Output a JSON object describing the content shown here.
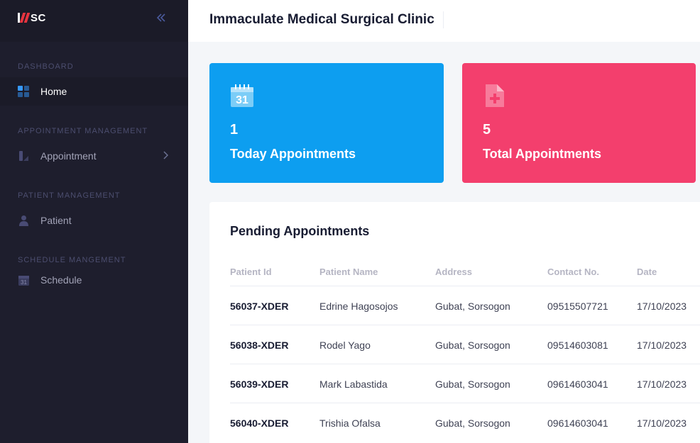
{
  "brand": {
    "logo_text": "SC"
  },
  "sidebar": {
    "sections": [
      {
        "label": "DASHBOARD"
      },
      {
        "label": "APPOINTMENT MANAGEMENT"
      },
      {
        "label": "PATIENT MANAGEMENT"
      },
      {
        "label": "SCHEDULE MANGEMENT"
      }
    ],
    "items": [
      {
        "label": "Home",
        "icon": "dashboard-grid-icon",
        "active": true
      },
      {
        "label": "Appointment",
        "icon": "appointment-icon",
        "has_submenu": true
      },
      {
        "label": "Patient",
        "icon": "user-icon"
      },
      {
        "label": "Schedule",
        "icon": "calendar-icon",
        "icon_text": "31"
      }
    ]
  },
  "header": {
    "title": "Immaculate Medical Surgical Clinic"
  },
  "stats": [
    {
      "value": "1",
      "label": "Today Appointments",
      "color": "#0d9ef0",
      "icon": "calendar-icon",
      "icon_text": "31"
    },
    {
      "value": "5",
      "label": "Total Appointments",
      "color": "#f33f6d",
      "icon": "medical-file-icon"
    }
  ],
  "pending": {
    "title": "Pending Appointments",
    "columns": [
      "Patient Id",
      "Patient Name",
      "Address",
      "Contact No.",
      "Date"
    ],
    "rows": [
      {
        "id": "56037-XDER",
        "name": "Edrine Hagosojos",
        "address": "Gubat, Sorsogon",
        "contact": "09515507721",
        "date": "17/10/2023"
      },
      {
        "id": "56038-XDER",
        "name": "Rodel Yago",
        "address": "Gubat, Sorsogon",
        "contact": "09514603081",
        "date": "17/10/2023"
      },
      {
        "id": "56039-XDER",
        "name": "Mark Labastida",
        "address": "Gubat, Sorsogon",
        "contact": "09614603041",
        "date": "17/10/2023"
      },
      {
        "id": "56040-XDER",
        "name": "Trishia Ofalsa",
        "address": "Gubat, Sorsogon",
        "contact": "09614603041",
        "date": "17/10/2023"
      }
    ]
  },
  "colors": {
    "sidebar_bg": "#1e1e2d",
    "accent_blue": "#0d9ef0",
    "accent_pink": "#f33f6d"
  }
}
